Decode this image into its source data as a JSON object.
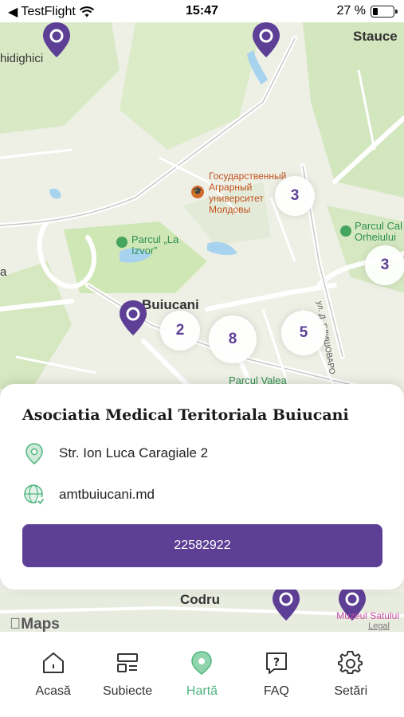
{
  "status_bar": {
    "back_app": "TestFlight",
    "time": "15:47",
    "battery_text": "27 %",
    "battery_level": 0.27
  },
  "map": {
    "labels": {
      "top_left": "hidighici",
      "top_right": "Stauce",
      "buiucani": "Buiucani",
      "codru": "Codru",
      "left_edge": "a"
    },
    "university": "Государственный Аграрный университет Молдовы",
    "parks": {
      "la_izvor": "Parcul „La Izvor”",
      "orheiului": "Parcul Cal Orheiului",
      "valea": "Parcul Valea"
    },
    "street_ru": "ул. Д. ЕЛИШОВАРО",
    "clusters": [
      "3",
      "3",
      "2",
      "8",
      "5"
    ],
    "museum": "Muzeul Satului",
    "maps_brand": "Maps",
    "legal": "Legal"
  },
  "card": {
    "title": "Asociatia Medical Teritoriala Buiucani",
    "address": "Str. Ion Luca Caragiale 2",
    "website": "amtbuiucani.md",
    "phone": "22582922"
  },
  "tabs": [
    {
      "label": "Acasă",
      "icon": "home-icon"
    },
    {
      "label": "Subiecte",
      "icon": "subjects-icon"
    },
    {
      "label": "Hartă",
      "icon": "map-pin-icon"
    },
    {
      "label": "FAQ",
      "icon": "faq-icon"
    },
    {
      "label": "Setări",
      "icon": "gear-icon"
    }
  ],
  "colors": {
    "accent": "#5e3f96",
    "active_tab": "#4fb57f",
    "map_background": "#eef0e6",
    "park_green": "#cfe6b5"
  }
}
